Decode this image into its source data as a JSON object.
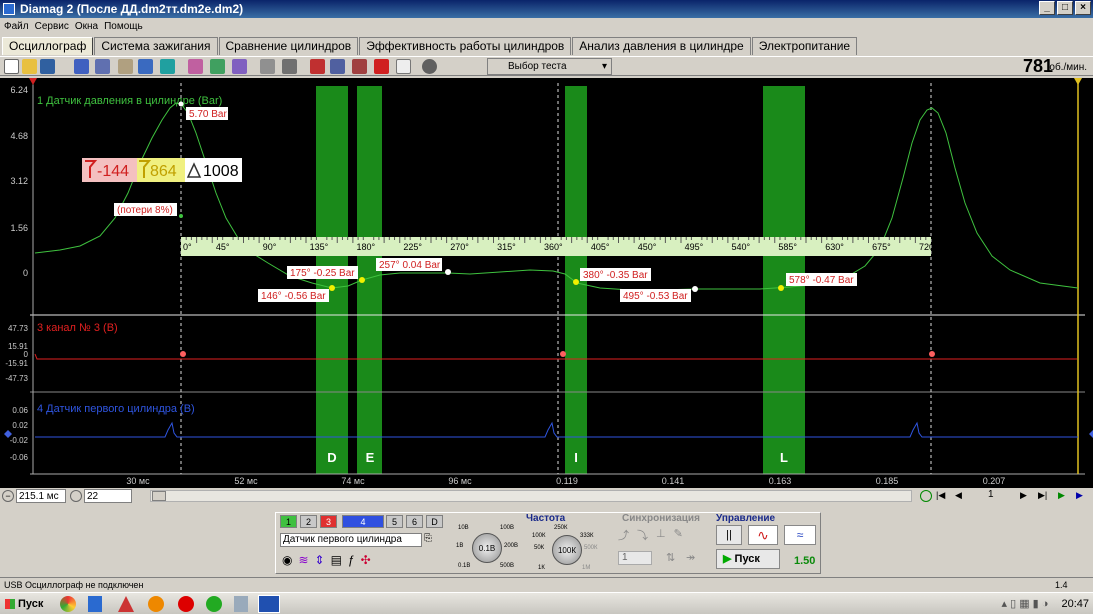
{
  "window": {
    "title": "Diamag 2 (После ДД.dm2тт.dm2e.dm2)"
  },
  "menu": [
    "Файл",
    "Сервис",
    "Окна",
    "Помощь"
  ],
  "tabs": [
    "Осциллограф",
    "Система зажигания",
    "Сравнение цилиндров",
    "Эффективность работы цилиндров",
    "Анализ давления в цилиндре",
    "Электропитание"
  ],
  "active_tab": 0,
  "toolbar": {
    "test_selector": "Выбор теста",
    "rpm_value": "781",
    "rpm_unit": "об./мин."
  },
  "scope": {
    "channel1": {
      "label": "1 Датчик давления в цилиндре (Bar)",
      "color": "#3fc23f",
      "yticks": [
        "6.24",
        "4.68",
        "3.12",
        "1.56",
        "0"
      ]
    },
    "channel3": {
      "label": "3 канал № 3 (В)",
      "color": "#e02020",
      "yticks": [
        "47.73",
        "15.91",
        "0",
        "-15.91",
        "-47.73"
      ]
    },
    "channel4": {
      "label": "4 Датчик первого цилиндра (В)",
      "color": "#2f55e0",
      "yticks": [
        "0.06",
        "0.02",
        "-0.02",
        "-0.06"
      ]
    },
    "xticks": [
      "30 мс",
      "52 мс",
      "74 мс",
      "96 мс",
      "0.119",
      "0.141",
      "0.163",
      "0.185",
      "0.207"
    ],
    "cursor_box": {
      "a": "-144",
      "b": "864",
      "delta": "1008"
    },
    "peak_label": "5.70 Bar",
    "loss_label": "(потери 8%)",
    "angle_ticks": [
      "0°",
      "45°",
      "90°",
      "135°",
      "180°",
      "225°",
      "270°",
      "315°",
      "360°",
      "405°",
      "450°",
      "495°",
      "540°",
      "585°",
      "630°",
      "675°",
      "720°"
    ],
    "points": [
      "175° -0.25 Bar",
      "146° -0.56 Bar",
      "257° 0.04 Bar",
      "380° -0.35 Bar",
      "495° -0.53 Bar",
      "578° -0.47 Bar"
    ],
    "phase_letters": [
      "D",
      "E",
      "I",
      "L"
    ]
  },
  "scrollbar": {
    "timebase": "215.1 мс",
    "count": "22",
    "page": "1"
  },
  "control": {
    "channels": [
      "1",
      "2",
      "3",
      "4",
      "5",
      "6",
      "D"
    ],
    "sensor": "Датчик первого цилиндра",
    "dial1": {
      "center": "0.1В",
      "labels": [
        "10В",
        "100В",
        "1В",
        "200В",
        "0.1В",
        "500В"
      ]
    },
    "freq_title": "Частота",
    "dial2": {
      "center": "100К",
      "labels": [
        "250К",
        "100К",
        "333К",
        "50К",
        "500К",
        "1К",
        "1М"
      ]
    },
    "sync_title": "Синхронизация",
    "sync_value": "1",
    "control_title": "Управление",
    "start_label": "Пуск",
    "version_value": "1.50"
  },
  "status": {
    "left": "USB Осциллограф не подключен",
    "right": "1.4"
  },
  "taskbar": {
    "start": "Пуск",
    "time": "20:47"
  }
}
